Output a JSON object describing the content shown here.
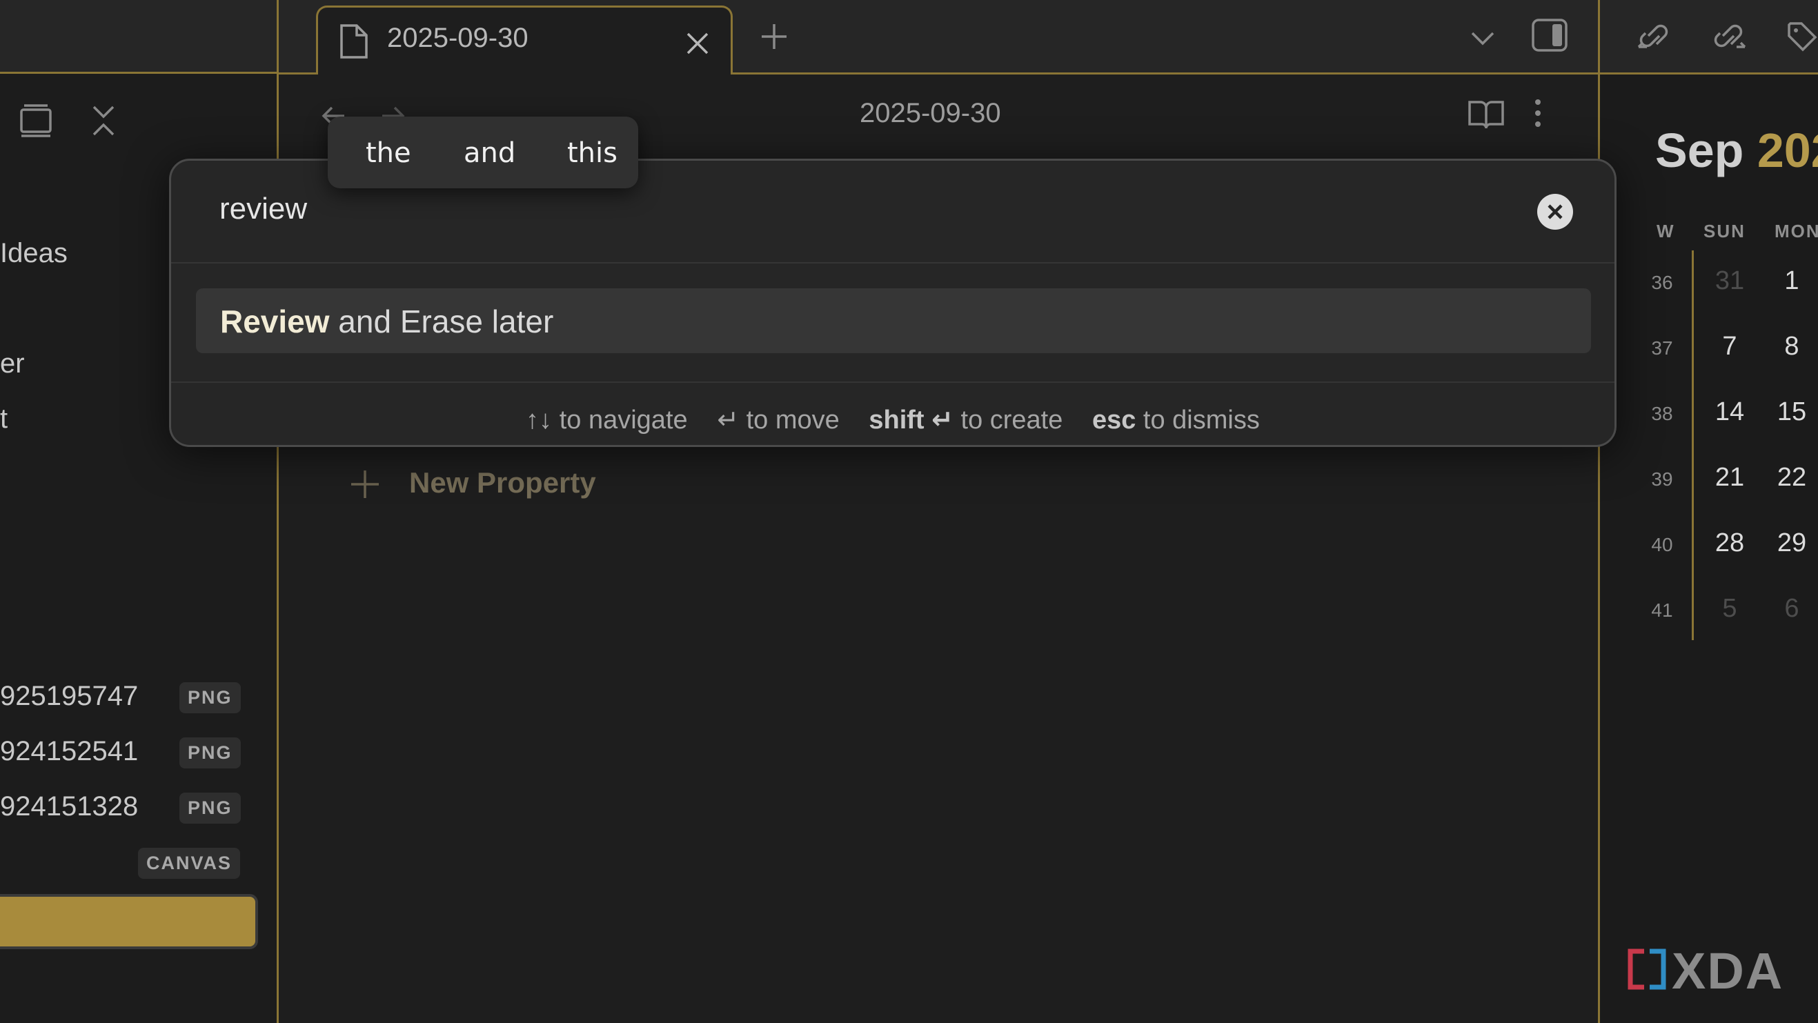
{
  "tab": {
    "title": "2025-09-30"
  },
  "note": {
    "title": "2025-09-30",
    "new_property_label": "New Property"
  },
  "autocomplete": {
    "words": [
      "the",
      "and",
      "this"
    ]
  },
  "modal": {
    "query": "review",
    "suggestion_bold": "Review",
    "suggestion_rest": " and Erase later",
    "hints": {
      "navigate_keys": "↑↓",
      "navigate_text": "to navigate",
      "move_key": "↵",
      "move_text": "to move",
      "create_key": "shift ↵",
      "create_text": "to create",
      "dismiss_key": "esc",
      "dismiss_text": "to dismiss"
    }
  },
  "sidebar": {
    "items": [
      "Ideas",
      "er",
      "t"
    ],
    "files": [
      {
        "name": "925195747",
        "ext": "PNG"
      },
      {
        "name": "924152541",
        "ext": "PNG"
      },
      {
        "name": "924151328",
        "ext": "PNG"
      }
    ],
    "canvas_badge": "CANVAS"
  },
  "calendar": {
    "month": "Sep",
    "year": "202",
    "headers": [
      "W",
      "SUN",
      "MON"
    ],
    "rows": [
      {
        "week": "36",
        "sun": "31",
        "mon": "1",
        "sun_dim": true,
        "mon_dim": false
      },
      {
        "week": "37",
        "sun": "7",
        "mon": "8",
        "sun_dim": false,
        "mon_dim": false
      },
      {
        "week": "38",
        "sun": "14",
        "mon": "15",
        "sun_dim": false,
        "mon_dim": false
      },
      {
        "week": "39",
        "sun": "21",
        "mon": "22",
        "sun_dim": false,
        "mon_dim": false
      },
      {
        "week": "40",
        "sun": "28",
        "mon": "29",
        "sun_dim": false,
        "mon_dim": false
      },
      {
        "week": "41",
        "sun": "5",
        "mon": "6",
        "sun_dim": true,
        "mon_dim": true
      }
    ]
  },
  "watermark": {
    "text": "XDA"
  },
  "colors": {
    "accent": "#8a7535",
    "gold": "#a88b3c",
    "year": "#b59a4c"
  }
}
